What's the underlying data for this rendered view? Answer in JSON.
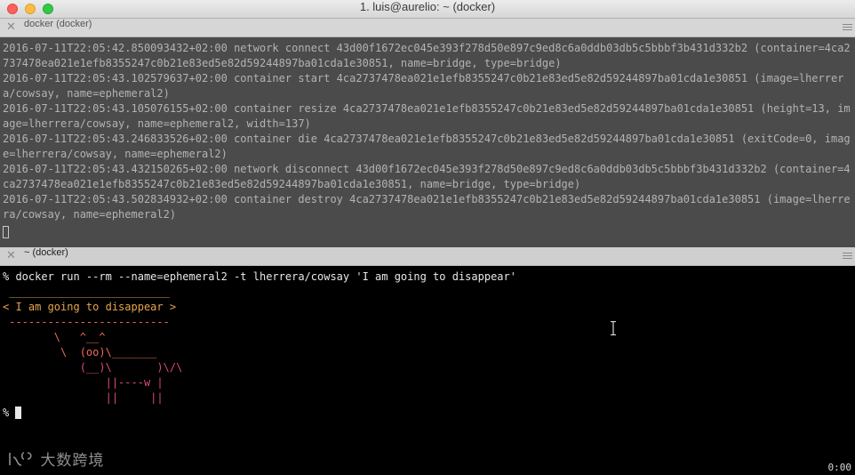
{
  "window": {
    "title": "1. luis@aurelio: ~ (docker)"
  },
  "tabs": [
    {
      "close": "✕",
      "title": "docker (docker)"
    },
    {
      "close": "✕",
      "title": "~ (docker)"
    }
  ],
  "top_pane": {
    "log": "2016-07-11T22:05:42.850093432+02:00 network connect 43d00f1672ec045e393f278d50e897c9ed8c6a0ddb03db5c5bbbf3b431d332b2 (container=4ca2737478ea021e1efb8355247c0b21e83ed5e82d59244897ba01cda1e30851, name=bridge, type=bridge)\n2016-07-11T22:05:43.102579637+02:00 container start 4ca2737478ea021e1efb8355247c0b21e83ed5e82d59244897ba01cda1e30851 (image=lherrera/cowsay, name=ephemeral2)\n2016-07-11T22:05:43.105076155+02:00 container resize 4ca2737478ea021e1efb8355247c0b21e83ed5e82d59244897ba01cda1e30851 (height=13, image=lherrera/cowsay, name=ephemeral2, width=137)\n2016-07-11T22:05:43.246833526+02:00 container die 4ca2737478ea021e1efb8355247c0b21e83ed5e82d59244897ba01cda1e30851 (exitCode=0, image=lherrera/cowsay, name=ephemeral2)\n2016-07-11T22:05:43.432150265+02:00 network disconnect 43d00f1672ec045e393f278d50e897c9ed8c6a0ddb03db5c5bbbf3b431d332b2 (container=4ca2737478ea021e1efb8355247c0b21e83ed5e82d59244897ba01cda1e30851, name=bridge, type=bridge)\n2016-07-11T22:05:43.502834932+02:00 container destroy 4ca2737478ea021e1efb8355247c0b21e83ed5e82d59244897ba01cda1e30851 (image=lherrera/cowsay, name=ephemeral2)"
  },
  "bottom_pane": {
    "command": "% docker run --rm --name=ephemeral2 -t lherrera/cowsay 'I am going to disappear'",
    "cowsay": [
      " _________________________",
      "< I am going to disappear >",
      " -------------------------",
      "        \\   ^__^",
      "         \\  (oo)\\_______",
      "            (__)\\       )\\/\\",
      "                ||----w |",
      "                ||     ||"
    ],
    "prompt": "% "
  },
  "watermark": "大数跨境",
  "timer": "0:00",
  "colors": {
    "top_pane_bg": "#4b4b4b",
    "bottom_pane_bg": "#000000",
    "cow_orange": "#e4a44c",
    "cow_red": "#f06a58",
    "cow_pink": "#d94a7a"
  }
}
